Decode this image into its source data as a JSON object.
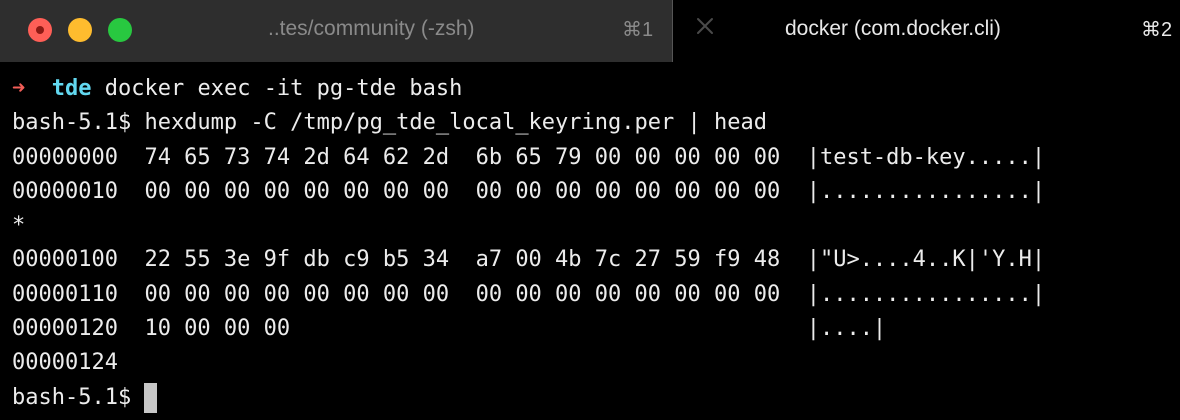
{
  "window": {
    "tabs": [
      {
        "title": "..tes/community (-zsh)",
        "shortcut": "⌘1",
        "active": true
      },
      {
        "title": "docker (com.docker.cli)",
        "shortcut": "⌘2",
        "active": false
      }
    ],
    "colors": {
      "close": "#ff5f57",
      "minimize": "#febc2e",
      "zoom": "#28c840",
      "prompt_arrow": "#f35e58",
      "prompt_dir": "#62d8f0",
      "text": "#ececec",
      "background": "#000000"
    },
    "icons": [
      "close-icon",
      "minimize-icon",
      "zoom-icon",
      "tab-close-icon"
    ]
  },
  "terminal": {
    "prompt": {
      "arrow": "➜",
      "dir": "tde",
      "command": "docker exec -it pg-tde bash"
    },
    "lines": [
      "bash-5.1$ hexdump -C /tmp/pg_tde_local_keyring.per | head",
      "00000000  74 65 73 74 2d 64 62 2d  6b 65 79 00 00 00 00 00  |test-db-key.....|",
      "00000010  00 00 00 00 00 00 00 00  00 00 00 00 00 00 00 00  |................|",
      "*",
      "00000100  22 55 3e 9f db c9 b5 34  a7 00 4b 7c 27 59 f9 48  |\"U>....4..K|'Y.H|",
      "00000110  00 00 00 00 00 00 00 00  00 00 00 00 00 00 00 00  |................|",
      "00000120  10 00 00 00                                       |....|",
      "00000124"
    ],
    "current_prompt": "bash-5.1$"
  }
}
